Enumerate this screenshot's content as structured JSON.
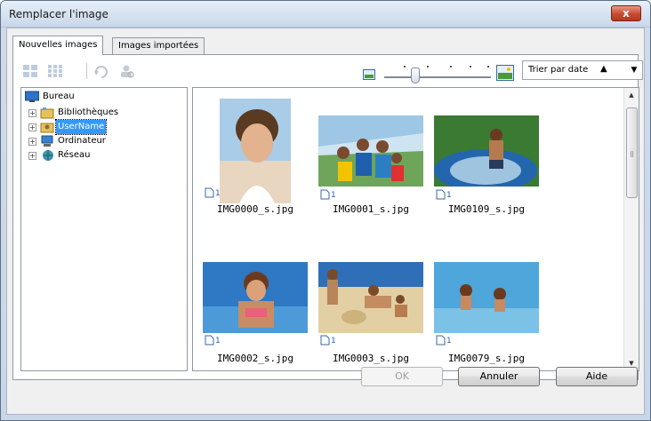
{
  "window": {
    "title": "Remplacer l'image",
    "close_label": "x"
  },
  "tabs": [
    {
      "label": "Nouvelles images"
    },
    {
      "label": "Images importées"
    }
  ],
  "toolbar": {
    "sort_label": "Trier par date",
    "sort_direction_glyph": "▲",
    "dropdown_glyph": "▼",
    "icons": [
      "view-large-icon",
      "view-grid-icon",
      "rotate-icon",
      "person-search-icon"
    ]
  },
  "tree": {
    "items": [
      {
        "label": "Bureau",
        "icon": "desktop-icon",
        "level": 0
      },
      {
        "label": "Bibliothèques",
        "icon": "library-icon",
        "level": 1
      },
      {
        "label": "UserName",
        "icon": "user-folder-icon",
        "level": 1,
        "selected": true
      },
      {
        "label": "Ordinateur",
        "icon": "computer-icon",
        "level": 1
      },
      {
        "label": "Réseau",
        "icon": "network-icon",
        "level": 1
      }
    ]
  },
  "gallery": {
    "items": [
      {
        "filename": "IMG0000_s.jpg",
        "count": "1"
      },
      {
        "filename": "IMG0001_s.jpg",
        "count": "1"
      },
      {
        "filename": "IMG0109_s.jpg",
        "count": "1"
      },
      {
        "filename": "IMG0002_s.jpg",
        "count": "1"
      },
      {
        "filename": "IMG0003_s.jpg",
        "count": "1"
      },
      {
        "filename": "IMG0079_s.jpg",
        "count": "1"
      }
    ]
  },
  "buttons": {
    "ok": "OK",
    "cancel": "Annuler",
    "help": "Aide"
  },
  "colors": {
    "selection": "#3399ff",
    "accent": "#2a5db0"
  }
}
